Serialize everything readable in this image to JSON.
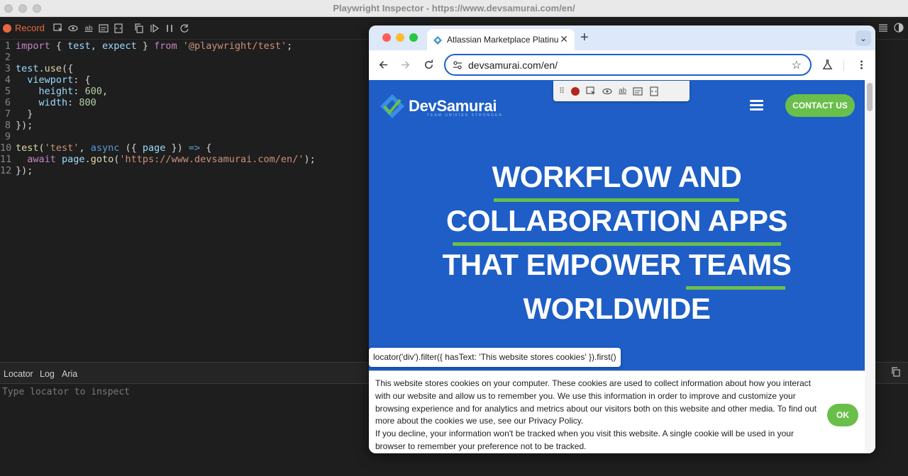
{
  "inspector": {
    "window_title": "Playwright Inspector - https://www.devsamurai.com/en/",
    "record_label": "Record",
    "code_lines": [
      "1",
      "2",
      "3",
      "4",
      "5",
      "6",
      "7",
      "8",
      "9",
      "10",
      "11",
      "12"
    ],
    "bottom_tabs": [
      "Locator",
      "Log",
      "Aria"
    ],
    "locator_placeholder": "Type locator to inspect"
  },
  "browser": {
    "tab_title": "Atlassian Marketplace Platinum Partner",
    "tab_close": "✕",
    "new_tab": "+",
    "tab_menu": "⌄",
    "url": "devsamurai.com/en/"
  },
  "page": {
    "brand": "DevSamurai",
    "tagline": "TEAM UNIFIED STRONGER",
    "contact_label": "CONTACT US",
    "hero_lines": [
      "WORKFLOW AND",
      "COLLABORATION APPS",
      "THAT EMPOWER TEAMS",
      "WORLDWIDE"
    ],
    "locator_tooltip": "locator('div').filter({ hasText: 'This website stores cookies' }).first()",
    "cookie_text_1": "This website stores cookies on your computer. These cookies are used to collect information about how you interact with our website and allow us to remember you. We use this information in order to improve and customize your browsing experience and for analytics and metrics about our visitors both on this website and other media. To find out more about the cookies we use, see our Privacy Policy.",
    "cookie_text_2": "If you decline, your information won't be tracked when you visit this website. A single cookie will be used in your browser to remember your preference not to be tracked.",
    "ok_label": "OK"
  },
  "colors": {
    "accent_green": "#6abf4b",
    "hero_blue": "#1e5ec6",
    "record_orange": "#e8683f"
  }
}
